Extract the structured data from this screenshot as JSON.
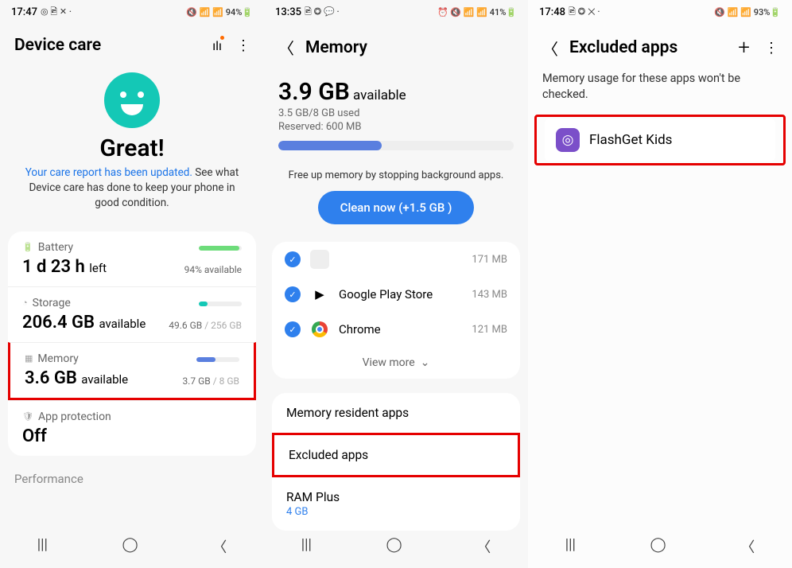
{
  "p1": {
    "status": {
      "time": "17:47",
      "icons_left": "◎ 🖻 ✕ ·",
      "icons_right": "🔇 📶 📶 94%🔋",
      "pct": "94%"
    },
    "title": "Device care",
    "great": "Great!",
    "report_link": "Your care report has been updated.",
    "report_rest": " See what Device care has done to keep your phone in good condition.",
    "battery": {
      "label": "Battery",
      "value": "1 d 23 h",
      "unit": "left",
      "sub": "94% available"
    },
    "storage": {
      "label": "Storage",
      "value": "206.4 GB",
      "unit": "available",
      "used": "49.6 GB",
      "total": " / 256 GB"
    },
    "memory": {
      "label": "Memory",
      "value": "3.6 GB",
      "unit": "available",
      "used": "3.7 GB",
      "total": " / 8 GB"
    },
    "protection": {
      "label": "App protection",
      "value": "Off"
    },
    "performance": "Performance"
  },
  "p2": {
    "status": {
      "time": "13:35",
      "icons_left": "🖻 ◎ 💬 ·",
      "icons_right": "⏰ 🔇 📶 📶 41%🔋"
    },
    "title": "Memory",
    "avail_val": "3.9 GB",
    "avail_label": " available",
    "used": "3.5 GB/8 GB used",
    "reserved": "Reserved: 600 MB",
    "hint": "Free up memory by stopping background apps.",
    "clean": "Clean now (+1.5 GB )",
    "apps": [
      {
        "name": "",
        "size": "171 MB"
      },
      {
        "name": "Google Play Store",
        "size": "143 MB"
      },
      {
        "name": "Chrome",
        "size": "121 MB"
      }
    ],
    "viewmore": "View more",
    "resident": "Memory resident apps",
    "excluded": "Excluded apps",
    "ramplus": {
      "label": "RAM Plus",
      "value": "4 GB"
    }
  },
  "p3": {
    "status": {
      "time": "17:48",
      "icons_left": "🖻 ◎ ✕ ·",
      "icons_right": "🔇 📶 📶 93%🔋"
    },
    "title": "Excluded apps",
    "desc": "Memory usage for these apps won't be checked.",
    "app": {
      "name": "FlashGet Kids"
    }
  }
}
